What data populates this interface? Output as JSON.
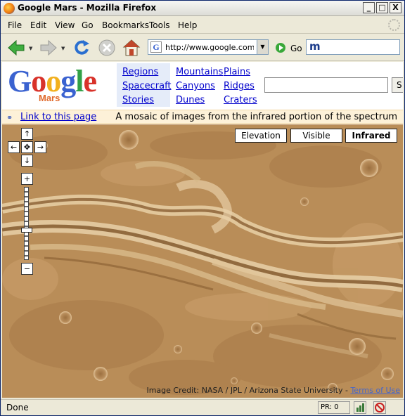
{
  "window": {
    "title": "Google Mars - Mozilla Firefox",
    "buttons": [
      "_",
      "□",
      "X"
    ]
  },
  "menu": {
    "items": [
      {
        "label": "File"
      },
      {
        "label": "Edit"
      },
      {
        "label": "View"
      },
      {
        "label": "Go"
      },
      {
        "label": "Bookmarks"
      },
      {
        "label": "Tools"
      },
      {
        "label": "Help"
      }
    ]
  },
  "toolbar": {
    "url": "http://www.google.com/r",
    "go_label": "Go",
    "search_engine_glyph": "m"
  },
  "logo": {
    "letters": [
      {
        "ch": "G",
        "color": "#3a62d0"
      },
      {
        "ch": "o",
        "color": "#d8322a"
      },
      {
        "ch": "o",
        "color": "#f2b01e"
      },
      {
        "ch": "g",
        "color": "#3a62d0"
      },
      {
        "ch": "l",
        "color": "#32a047"
      },
      {
        "ch": "e",
        "color": "#d8322a"
      }
    ],
    "subtitle": "Mars"
  },
  "nav": {
    "col1": [
      "Regions",
      "Spacecraft",
      "Stories"
    ],
    "col2": [
      "Mountains",
      "Canyons",
      "Dunes"
    ],
    "col3": [
      "Plains",
      "Ridges",
      "Craters"
    ]
  },
  "search": {
    "value": "",
    "button_partial": "S"
  },
  "infobar": {
    "link_label": "Link to this page",
    "description": "A mosaic of images from the infrared portion of the spectrum"
  },
  "map": {
    "types": [
      {
        "label": "Elevation",
        "active": false
      },
      {
        "label": "Visible",
        "active": false
      },
      {
        "label": "Infrared",
        "active": true
      }
    ],
    "controls": {
      "pan_up": "↑",
      "pan_left": "←",
      "pan_center": "✥",
      "pan_right": "→",
      "pan_down": "↓",
      "zoom_in": "+",
      "zoom_out": "−"
    },
    "credit": "Image Credit: NASA / JPL / Arizona State University - ",
    "terms_label": "Terms of Use"
  },
  "status": {
    "text": "Done",
    "pr": "PR: 0"
  }
}
